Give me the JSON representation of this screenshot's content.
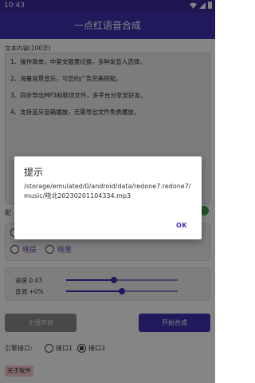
{
  "status_bar": {
    "time": "10:43"
  },
  "app_bar": {
    "title": "一点红语音合成"
  },
  "text_input": {
    "label": "文本内容(100字)",
    "lines": [
      "1、操作简单，中英文随意切换，多种发音人选择。",
      "2、海量背景音乐，与您的广告完美搭配。",
      "3、同步导出MP3和歌词文件，多平台分享至好友。",
      "4、支持蓝牙音箱播放，无需导出文件免费播放。"
    ]
  },
  "voice_row": {
    "label": "配"
  },
  "voices": [
    {
      "label": "晓辰",
      "selected": false
    },
    {
      "label": "晓墨",
      "selected": false
    }
  ],
  "params": {
    "speed": {
      "label": "语速 0.43",
      "value": 0.43
    },
    "pitch": {
      "label": "音调 +0%",
      "value": 0.5
    }
  },
  "buttons": {
    "main_voice": "主播声音",
    "start": "开始合成",
    "about": "关于软件"
  },
  "engine": {
    "label": "引擎接口:",
    "options": [
      {
        "label": "接口1",
        "selected": false
      },
      {
        "label": "接口2",
        "selected": true
      }
    ]
  },
  "dialog": {
    "title": "提示",
    "message": "/storage/emulated/0/android/data/redone7.redone7/music/晓北20230201104334.mp3",
    "ok": "OK"
  },
  "colors": {
    "primary": "#3f30b0",
    "status_bar": "#3a2a9c",
    "accent_green": "#43a047",
    "about_bg": "#f7c7cf"
  }
}
